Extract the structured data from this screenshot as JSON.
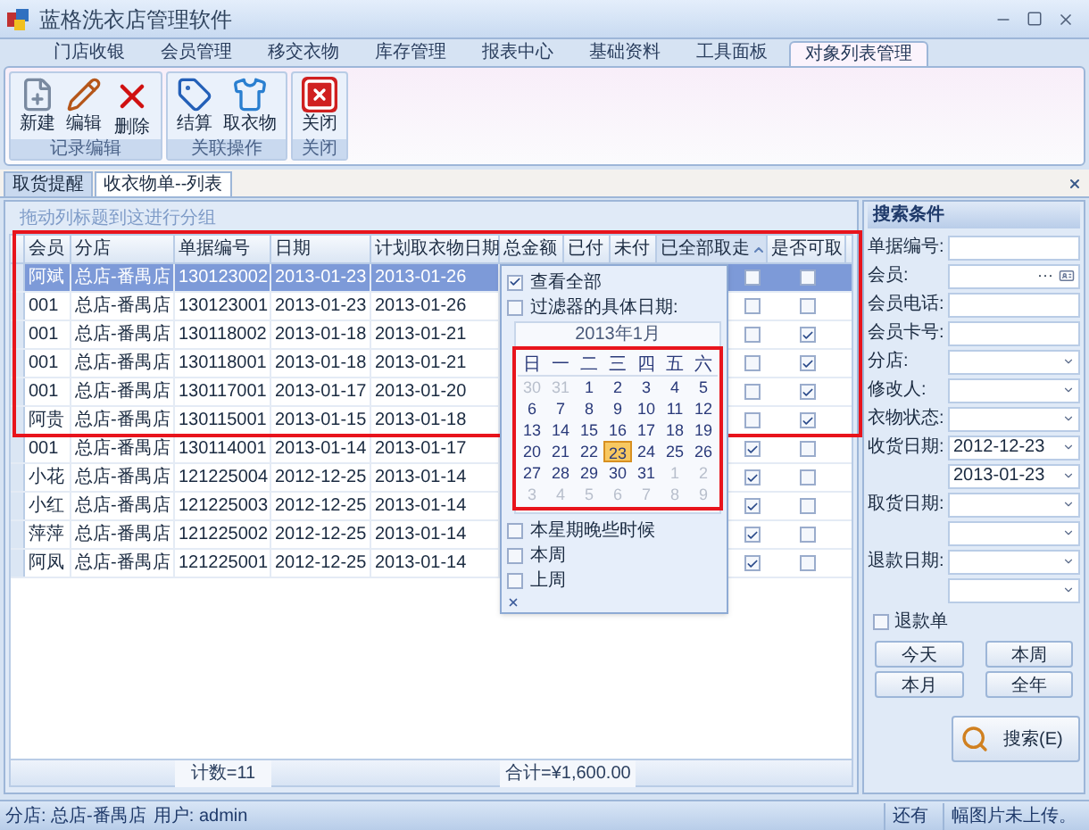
{
  "window": {
    "title": "蓝格洗衣店管理软件"
  },
  "ribbon_tabs": [
    {
      "label": "门店收银",
      "selected": false
    },
    {
      "label": "会员管理",
      "selected": false
    },
    {
      "label": "移交衣物",
      "selected": false
    },
    {
      "label": "库存管理",
      "selected": false
    },
    {
      "label": "报表中心",
      "selected": false
    },
    {
      "label": "基础资料",
      "selected": false
    },
    {
      "label": "工具面板",
      "selected": false
    },
    {
      "label": "对象列表管理",
      "selected": true
    }
  ],
  "ribbon_groups": [
    {
      "caption": "记录编辑",
      "buttons": [
        "新建",
        "编辑",
        "删除"
      ]
    },
    {
      "caption": "关联操作",
      "buttons": [
        "结算",
        "取衣物"
      ]
    },
    {
      "caption": "关闭",
      "buttons": [
        "关闭"
      ]
    }
  ],
  "doc_tabs": [
    {
      "label": "取货提醒",
      "selected": false
    },
    {
      "label": "收衣物单--列表",
      "selected": true
    }
  ],
  "group_hint": "拖动列标题到这进行分组",
  "columns": [
    {
      "label": "会员",
      "sorted": false
    },
    {
      "label": "分店",
      "sorted": false
    },
    {
      "label": "单据编号",
      "sorted": false
    },
    {
      "label": "日期",
      "sorted": false
    },
    {
      "label": "计划取衣物日期",
      "sorted": false
    },
    {
      "label": "总金额",
      "sorted": false
    },
    {
      "label": "已付",
      "sorted": false
    },
    {
      "label": "未付",
      "sorted": false
    },
    {
      "label": "已全部取走",
      "sorted": true
    },
    {
      "label": "是否可取",
      "sorted": false
    }
  ],
  "rows": [
    {
      "cells": [
        "阿斌",
        "总店-番禺店",
        "130123002",
        "2013-01-23",
        "2013-01-26"
      ],
      "all_taken": false,
      "can_take": false,
      "selected": true
    },
    {
      "cells": [
        "001",
        "总店-番禺店",
        "130123001",
        "2013-01-23",
        "2013-01-26"
      ],
      "all_taken": false,
      "can_take": false,
      "selected": false
    },
    {
      "cells": [
        "001",
        "总店-番禺店",
        "130118002",
        "2013-01-18",
        "2013-01-21"
      ],
      "all_taken": false,
      "can_take": true,
      "selected": false
    },
    {
      "cells": [
        "001",
        "总店-番禺店",
        "130118001",
        "2013-01-18",
        "2013-01-21"
      ],
      "all_taken": false,
      "can_take": true,
      "selected": false
    },
    {
      "cells": [
        "001",
        "总店-番禺店",
        "130117001",
        "2013-01-17",
        "2013-01-20"
      ],
      "all_taken": false,
      "can_take": true,
      "selected": false
    },
    {
      "cells": [
        "阿贵",
        "总店-番禺店",
        "130115001",
        "2013-01-15",
        "2013-01-18"
      ],
      "all_taken": false,
      "can_take": true,
      "selected": false
    },
    {
      "cells": [
        "001",
        "总店-番禺店",
        "130114001",
        "2013-01-14",
        "2013-01-17"
      ],
      "all_taken": true,
      "can_take": false,
      "selected": false
    },
    {
      "cells": [
        "小花",
        "总店-番禺店",
        "121225004",
        "2012-12-25",
        "2013-01-14"
      ],
      "all_taken": true,
      "can_take": false,
      "selected": false
    },
    {
      "cells": [
        "小红",
        "总店-番禺店",
        "121225003",
        "2012-12-25",
        "2013-01-14"
      ],
      "all_taken": true,
      "can_take": false,
      "selected": false
    },
    {
      "cells": [
        "萍萍",
        "总店-番禺店",
        "121225002",
        "2012-12-25",
        "2013-01-14"
      ],
      "all_taken": true,
      "can_take": false,
      "selected": false
    },
    {
      "cells": [
        "阿凤",
        "总店-番禺店",
        "121225001",
        "2012-12-25",
        "2013-01-14"
      ],
      "all_taken": true,
      "can_take": false,
      "selected": false
    }
  ],
  "footer": {
    "count": "计数=11",
    "total": "合计=¥1,600.00"
  },
  "filter_popup": {
    "options_top": [
      {
        "label": "查看全部",
        "checked": true
      },
      {
        "label": "过滤器的具体日期:",
        "checked": false
      }
    ],
    "calendar": {
      "title": "2013年1月",
      "weekdays": [
        "日",
        "一",
        "二",
        "三",
        "四",
        "五",
        "六"
      ],
      "weeks": [
        [
          {
            "day": "30",
            "outside": true,
            "selected": false
          },
          {
            "day": "31",
            "outside": true,
            "selected": false
          },
          {
            "day": "1",
            "outside": false,
            "selected": false
          },
          {
            "day": "2",
            "outside": false,
            "selected": false
          },
          {
            "day": "3",
            "outside": false,
            "selected": false
          },
          {
            "day": "4",
            "outside": false,
            "selected": false
          },
          {
            "day": "5",
            "outside": false,
            "selected": false
          }
        ],
        [
          {
            "day": "6",
            "outside": false,
            "selected": false
          },
          {
            "day": "7",
            "outside": false,
            "selected": false
          },
          {
            "day": "8",
            "outside": false,
            "selected": false
          },
          {
            "day": "9",
            "outside": false,
            "selected": false
          },
          {
            "day": "10",
            "outside": false,
            "selected": false
          },
          {
            "day": "11",
            "outside": false,
            "selected": false
          },
          {
            "day": "12",
            "outside": false,
            "selected": false
          }
        ],
        [
          {
            "day": "13",
            "outside": false,
            "selected": false
          },
          {
            "day": "14",
            "outside": false,
            "selected": false
          },
          {
            "day": "15",
            "outside": false,
            "selected": false
          },
          {
            "day": "16",
            "outside": false,
            "selected": false
          },
          {
            "day": "17",
            "outside": false,
            "selected": false
          },
          {
            "day": "18",
            "outside": false,
            "selected": false
          },
          {
            "day": "19",
            "outside": false,
            "selected": false
          }
        ],
        [
          {
            "day": "20",
            "outside": false,
            "selected": false
          },
          {
            "day": "21",
            "outside": false,
            "selected": false
          },
          {
            "day": "22",
            "outside": false,
            "selected": false
          },
          {
            "day": "23",
            "outside": false,
            "selected": true
          },
          {
            "day": "24",
            "outside": false,
            "selected": false
          },
          {
            "day": "25",
            "outside": false,
            "selected": false
          },
          {
            "day": "26",
            "outside": false,
            "selected": false
          }
        ],
        [
          {
            "day": "27",
            "outside": false,
            "selected": false
          },
          {
            "day": "28",
            "outside": false,
            "selected": false
          },
          {
            "day": "29",
            "outside": false,
            "selected": false
          },
          {
            "day": "30",
            "outside": false,
            "selected": false
          },
          {
            "day": "31",
            "outside": false,
            "selected": false
          },
          {
            "day": "1",
            "outside": true,
            "selected": false
          },
          {
            "day": "2",
            "outside": true,
            "selected": false
          }
        ],
        [
          {
            "day": "3",
            "outside": true,
            "selected": false
          },
          {
            "day": "4",
            "outside": true,
            "selected": false
          },
          {
            "day": "5",
            "outside": true,
            "selected": false
          },
          {
            "day": "6",
            "outside": true,
            "selected": false
          },
          {
            "day": "7",
            "outside": true,
            "selected": false
          },
          {
            "day": "8",
            "outside": true,
            "selected": false
          },
          {
            "day": "9",
            "outside": true,
            "selected": false
          }
        ]
      ]
    },
    "options_bottom": [
      {
        "label": "本星期晚些时候",
        "checked": false
      },
      {
        "label": "本周",
        "checked": false
      },
      {
        "label": "上周",
        "checked": false
      }
    ]
  },
  "search_panel": {
    "title": "搜索条件",
    "fields": [
      {
        "label": "单据编号:",
        "kind": "text"
      },
      {
        "label": "会员:",
        "kind": "lookup",
        "button": "···"
      },
      {
        "label": "会员电话:",
        "kind": "text"
      },
      {
        "label": "会员卡号:",
        "kind": "text"
      },
      {
        "label": "分店:",
        "kind": "dropdown"
      },
      {
        "label": "修改人:",
        "kind": "dropdown"
      },
      {
        "label": "衣物状态:",
        "kind": "dropdown"
      },
      {
        "label": "收货日期:",
        "kind": "dropdown",
        "value": "2012-12-23"
      },
      {
        "kind": "dropdown",
        "value": "2013-01-23"
      },
      {
        "label": "取货日期:",
        "kind": "dropdown"
      },
      {
        "kind": "dropdown"
      },
      {
        "label": "退款日期:",
        "kind": "dropdown"
      },
      {
        "kind": "dropdown"
      }
    ],
    "refund_checkbox": {
      "label": "退款单",
      "checked": false
    },
    "quick_buttons": [
      "今天",
      "本周",
      "本月",
      "全年"
    ],
    "search_button": "搜索(E)"
  },
  "status_bar": {
    "branch": "分店: 总店-番禺店",
    "user": "用户: admin",
    "pending_prefix": "还有",
    "pending_text": "幅图片未上传。"
  }
}
